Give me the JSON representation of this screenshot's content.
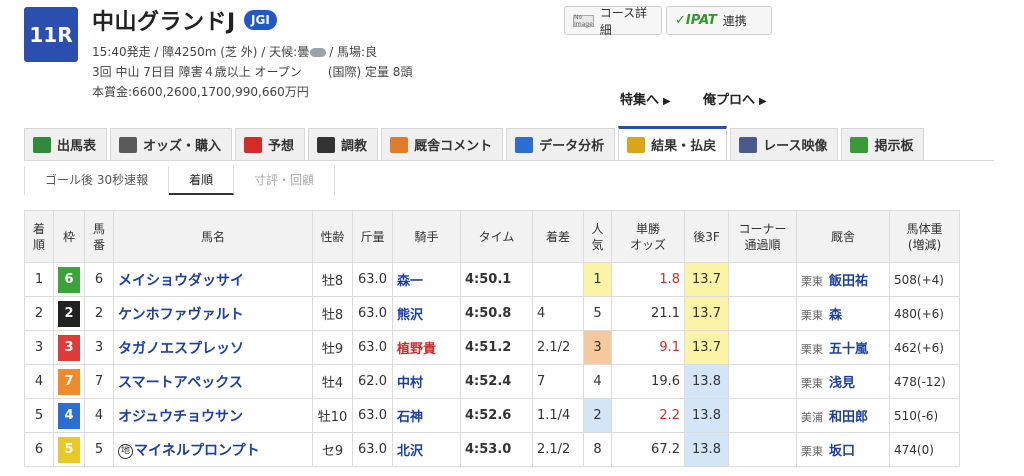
{
  "race": {
    "number": "11R",
    "name": "中山グランドJ",
    "grade": "JGI",
    "start_info": "15:40発走 / 障4250m (芝 外) / 天候:曇",
    "track_state": "/ 馬場:良",
    "meeting": "3回 中山 7日目 障害４歳以上 オープン",
    "conditions": "(国際) 定量 8頭",
    "prize": "本賞金:6600,2600,1700,990,660万円"
  },
  "header_buttons": {
    "course": "コース詳細",
    "course_map": "No Image",
    "ipat": "IPAT",
    "ipat_label": "連携"
  },
  "links": {
    "feature": "特集へ",
    "pro": "俺プロへ"
  },
  "tabs": [
    {
      "label": "出馬表",
      "icon": "entry-table-icon",
      "color": "#2e8b3a"
    },
    {
      "label": "オッズ・購入",
      "icon": "odds-icon",
      "color": "#5a5a5a"
    },
    {
      "label": "予想",
      "icon": "target-icon",
      "color": "#d42a2a"
    },
    {
      "label": "調教",
      "icon": "stopwatch-icon",
      "color": "#333333"
    },
    {
      "label": "厩舎コメント",
      "icon": "stable-icon",
      "color": "#e07b2a"
    },
    {
      "label": "データ分析",
      "icon": "bar-chart-icon",
      "color": "#2b6dd1"
    },
    {
      "label": "結果・払戻",
      "icon": "coins-icon",
      "color": "#d9a619",
      "active": true
    },
    {
      "label": "レース映像",
      "icon": "video-icon",
      "color": "#4a5a8a"
    },
    {
      "label": "掲示板",
      "icon": "chat-icon",
      "color": "#3a9a3a"
    }
  ],
  "subtabs": [
    {
      "label": "ゴール後 30秒速報"
    },
    {
      "label": "着順",
      "active": true
    },
    {
      "label": "寸評・回顧",
      "disabled": true
    }
  ],
  "table": {
    "headers": {
      "rank": "着\n順",
      "waku": "枠",
      "num": "馬\n番",
      "name": "馬名",
      "sexage": "性齢",
      "weight": "斤量",
      "jockey": "騎手",
      "time": "タイム",
      "margin": "着差",
      "pop": "人\n気",
      "odds": "単勝\nオッズ",
      "f3": "後3F",
      "corner": "コーナー\n通過順",
      "trainer": "厩舎",
      "bw": "馬体重\n(増減)"
    },
    "rows": [
      {
        "rank": "1",
        "waku": "6",
        "num": "6",
        "name": "メイショウダッサイ",
        "sexage": "牡8",
        "weight": "63.0",
        "jockey": "森一",
        "time": "4:50.1",
        "margin": "",
        "pop": "1",
        "odds": "1.8",
        "f3": "13.7",
        "corner": "",
        "trainer_loc": "栗東",
        "trainer": "飯田祐",
        "bw": "508(+4)"
      },
      {
        "rank": "2",
        "waku": "2",
        "num": "2",
        "name": "ケンホファヴァルト",
        "sexage": "牡8",
        "weight": "63.0",
        "jockey": "熊沢",
        "time": "4:50.8",
        "margin": "4",
        "pop": "5",
        "odds": "21.1",
        "f3": "13.7",
        "corner": "",
        "trainer_loc": "栗東",
        "trainer": "森",
        "bw": "480(+6)"
      },
      {
        "rank": "3",
        "waku": "3",
        "num": "3",
        "name": "タガノエスプレッソ",
        "sexage": "牡9",
        "weight": "63.0",
        "jockey": "植野貴",
        "time": "4:51.2",
        "margin": "2.1/2",
        "pop": "3",
        "odds": "9.1",
        "f3": "13.7",
        "corner": "",
        "trainer_loc": "栗東",
        "trainer": "五十嵐",
        "bw": "462(+6)"
      },
      {
        "rank": "4",
        "waku": "7",
        "num": "7",
        "name": "スマートアペックス",
        "sexage": "牡4",
        "weight": "62.0",
        "jockey": "中村",
        "time": "4:52.4",
        "margin": "7",
        "pop": "4",
        "odds": "19.6",
        "f3": "13.8",
        "corner": "",
        "trainer_loc": "栗東",
        "trainer": "浅見",
        "bw": "478(-12)"
      },
      {
        "rank": "5",
        "waku": "4",
        "num": "4",
        "name": "オジュウチョウサン",
        "sexage": "牡10",
        "weight": "63.0",
        "jockey": "石神",
        "time": "4:52.6",
        "margin": "1.1/4",
        "pop": "2",
        "odds": "2.2",
        "f3": "13.8",
        "corner": "",
        "trainer_loc": "美浦",
        "trainer": "和田郎",
        "bw": "510(-6)"
      },
      {
        "rank": "6",
        "waku": "5",
        "num": "5",
        "name": "マイネルプロンプト",
        "kuji": "地",
        "sexage": "セ9",
        "weight": "63.0",
        "jockey": "北沢",
        "time": "4:53.0",
        "margin": "2.1/2",
        "pop": "8",
        "odds": "67.2",
        "f3": "13.8",
        "corner": "",
        "trainer_loc": "栗東",
        "trainer": "坂口",
        "bw": "474(0)"
      }
    ]
  },
  "colors": {
    "accent": "#2b4fae",
    "waku": {
      "1": "#ffffff",
      "2": "#222222",
      "3": "#e03a3a",
      "4": "#2b6dd1",
      "5": "#e8c92a",
      "6": "#3aa33a",
      "7": "#f08a2a",
      "8": "#f07aa8"
    },
    "pop_highlight_1": "#fbf3a6",
    "pop_highlight_2": "#d4e5f7",
    "pop_highlight_3": "#f4c99c"
  }
}
